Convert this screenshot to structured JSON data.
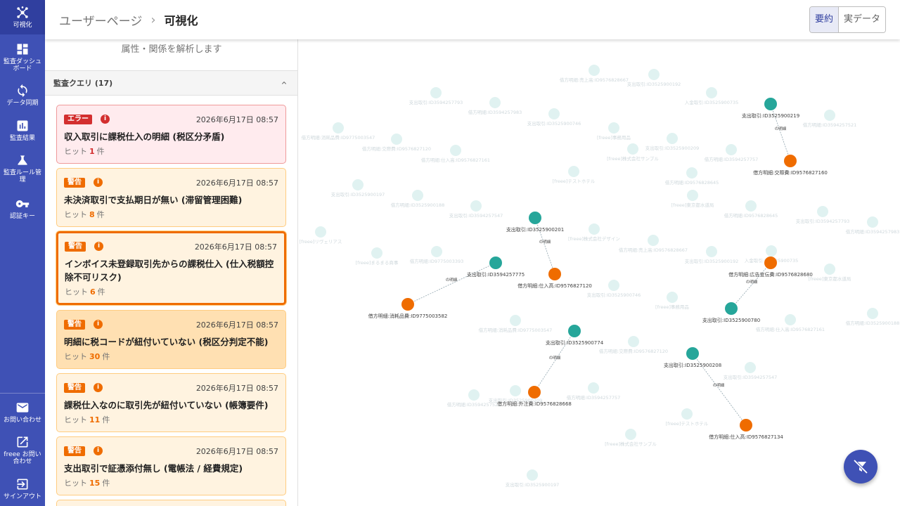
{
  "sidebar": {
    "items": [
      {
        "label": "可視化",
        "icon": "graph-icon",
        "active": true
      },
      {
        "label": "監査ダッシュ\nボード",
        "icon": "dashboard-icon"
      },
      {
        "label": "データ同期",
        "icon": "sync-icon"
      },
      {
        "label": "監査結果",
        "icon": "bar-chart-icon"
      },
      {
        "label": "監査ルール管\n理",
        "icon": "flask-icon"
      },
      {
        "label": "認証キー",
        "icon": "key-icon"
      }
    ],
    "bottom_items": [
      {
        "label": "お問い合わせ",
        "icon": "mail-icon"
      },
      {
        "label": "freee お問い\n合わせ",
        "icon": "external-link-icon"
      },
      {
        "label": "サインアウト",
        "icon": "logout-icon"
      }
    ]
  },
  "header": {
    "breadcrumb_root": "ユーザーページ",
    "breadcrumb_sep": "›",
    "breadcrumb_current": "可視化",
    "toggle_summary": "要約",
    "toggle_raw": "実データ"
  },
  "panel": {
    "subtitle": "属性・関係を解析します",
    "audit_title": "監査クエリ (17)",
    "hit_prefix": "ヒット",
    "hit_suffix": "件",
    "cards": [
      {
        "badge": "エラー",
        "date": "2026年6月17日 08:57",
        "title": "収入取引に課税仕入の明細 (税区分矛盾)",
        "hits": "1"
      },
      {
        "badge": "警告",
        "date": "2026年6月17日 08:57",
        "title": "未決済取引で支払期日が無い (滞留管理困難)",
        "hits": "8"
      },
      {
        "badge": "警告",
        "date": "2026年6月17日 08:57",
        "title": "インボイス未登録取引先からの課税仕入 (仕入税額控除不可リスク)",
        "hits": "6"
      },
      {
        "badge": "警告",
        "date": "2026年6月17日 08:57",
        "title": "明細に税コードが紐付いていない (税区分判定不能)",
        "hits": "30"
      },
      {
        "badge": "警告",
        "date": "2026年6月17日 08:57",
        "title": "課税仕入なのに取引先が紐付いていない (帳簿要件)",
        "hits": "11"
      },
      {
        "badge": "警告",
        "date": "2026年6月17日 08:57",
        "title": "支出取引で証憑添付無し (電帳法 / 経費規定)",
        "hits": "15"
      }
    ]
  },
  "graph": {
    "colors": {
      "deal": "#26a69a",
      "detail": "#ef6c00",
      "faded": "#e0f2f1"
    },
    "edge_label": "の明細",
    "nodes": [
      {
        "id": "d1",
        "label": "支出取引:ID3525900219",
        "kind": "deal"
      },
      {
        "id": "m1",
        "label": "借方明細:交際費:ID9576827160",
        "kind": "detail"
      },
      {
        "id": "d2",
        "label": "支出取引:ID3525900201",
        "kind": "deal"
      },
      {
        "id": "m2",
        "label": "借方明細:仕入高:ID9576827120",
        "kind": "detail"
      },
      {
        "id": "d3",
        "label": "支出取引:ID3594257775",
        "kind": "deal"
      },
      {
        "id": "m3",
        "label": "借方明細:消耗品費:ID9775003582",
        "kind": "detail"
      },
      {
        "id": "m4",
        "label": "借方明細:広告宣伝費:ID9576828680",
        "kind": "detail"
      },
      {
        "id": "d4",
        "label": "支出取引:ID3525900780",
        "kind": "deal"
      },
      {
        "id": "d5",
        "label": "支出取引:ID3525900774",
        "kind": "deal"
      },
      {
        "id": "m5",
        "label": "借方明細:外注費:ID9576828668",
        "kind": "detail"
      },
      {
        "id": "d6",
        "label": "支出取引:ID3525900208",
        "kind": "deal"
      },
      {
        "id": "m6",
        "label": "借方明細:仕入高:ID9576827134",
        "kind": "detail"
      }
    ],
    "edges": [
      {
        "from": "d1",
        "to": "m1"
      },
      {
        "from": "d2",
        "to": "m2"
      },
      {
        "from": "d3",
        "to": "m3"
      },
      {
        "from": "m4",
        "to": "d4"
      },
      {
        "from": "d5",
        "to": "m5"
      },
      {
        "from": "d6",
        "to": "m6"
      }
    ],
    "faded_labels": [
      "借方明細:売上高:ID9576828667",
      "支出取引:ID3525900192",
      "入金取引:ID3525900735",
      "支出取引:ID3594257793",
      "借方明細:ID3594257983",
      "支出取引:ID3525900746",
      "[freee]事務用品",
      "借方明細:消耗品費:ID9775003547",
      "借方明細:交際費:ID9576827120",
      "借方明細:仕入高:ID9576827161",
      "支出取引:ID3525900209",
      "借方明細:ID3594257757",
      "借方明細:ID3594257521",
      "[freee]テストホテル",
      "[freee]株式会社サンプル",
      "支出取引:ID3525900197",
      "借方明細:ID3525900188",
      "支出取引:ID3594257547",
      "[freee]東京都水道局",
      "借方明細:ID9576828645",
      "[freee]リヴェリアス",
      "[freee]まるまる商事",
      "借方明細:ID9775003393",
      "[freee]株式会社デザイン"
    ]
  }
}
